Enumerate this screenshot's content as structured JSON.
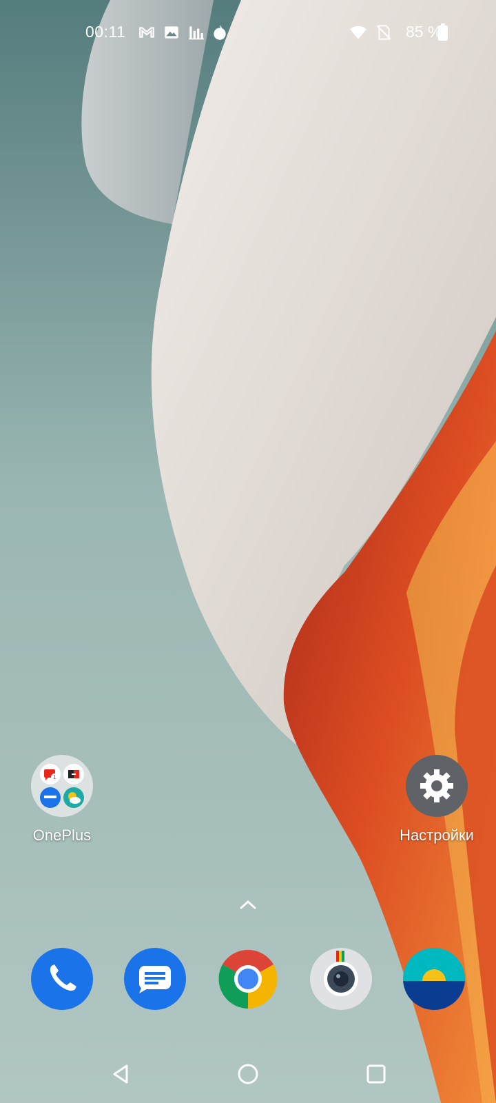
{
  "status_bar": {
    "time": "00:11",
    "battery_percent": "85 %",
    "notification_icons": [
      "gmail-icon",
      "gallery-icon",
      "chart-icon",
      "fire-icon"
    ],
    "system_icons": [
      "wifi-icon",
      "no-sim-icon",
      "battery-icon"
    ]
  },
  "home": {
    "folder": {
      "label": "OnePlus",
      "contents": [
        "message-red-icon",
        "switch-icon",
        "card-icon",
        "weather-icon"
      ]
    },
    "settings": {
      "label": "Настройки",
      "icon": "gear-icon"
    }
  },
  "app_drawer_hint": "chevron-up-icon",
  "dock": [
    {
      "name": "phone",
      "icon": "phone-icon",
      "color": "#1a73e8"
    },
    {
      "name": "messages",
      "icon": "messages-icon",
      "color": "#1a73e8"
    },
    {
      "name": "chrome",
      "icon": "chrome-icon",
      "color": "#4285f4"
    },
    {
      "name": "camera",
      "icon": "camera-icon",
      "color": "#dfe1e5"
    },
    {
      "name": "weather",
      "icon": "weather-sun-icon",
      "color": "#00a3a6"
    }
  ],
  "nav_bar": [
    "back-icon",
    "home-icon",
    "recents-icon"
  ],
  "colors": {
    "wallpaper_teal": "#5a7f80",
    "wallpaper_cream": "#dcd5cf",
    "wallpaper_orange": "#e0522a"
  }
}
